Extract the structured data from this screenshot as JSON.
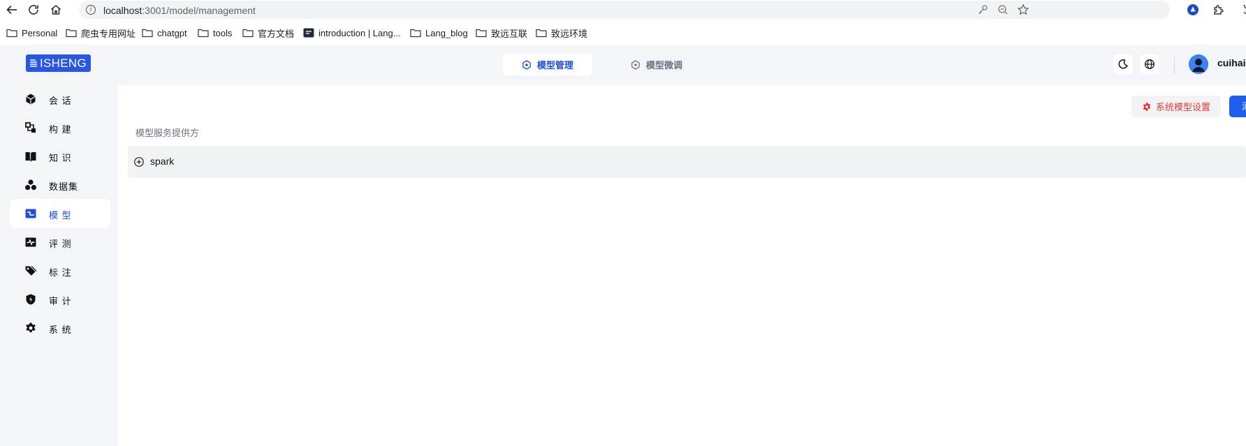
{
  "browser": {
    "url_host": "localhost",
    "url_path": ":3001/model/management",
    "bookmarks": [
      {
        "label": "Personal",
        "icon": "folder-icon"
      },
      {
        "label": "爬虫专用网址",
        "icon": "folder-icon"
      },
      {
        "label": "chatgpt",
        "icon": "folder-icon"
      },
      {
        "label": "tools",
        "icon": "folder-icon"
      },
      {
        "label": "官方文档",
        "icon": "folder-icon"
      },
      {
        "label": "introduction | Lang...",
        "icon": "site-icon"
      },
      {
        "label": "Lang_blog",
        "icon": "folder-icon"
      },
      {
        "label": "致远互联",
        "icon": "folder-icon"
      },
      {
        "label": "致远环境",
        "icon": "folder-icon"
      }
    ]
  },
  "header": {
    "logo_text": "ISHENG",
    "tabs": [
      {
        "label": "模型管理",
        "active": true
      },
      {
        "label": "模型微调",
        "active": false
      }
    ],
    "username": "cuihail"
  },
  "sidebar": {
    "items": [
      {
        "label": "会 话",
        "icon": "cube-icon",
        "active": false
      },
      {
        "label": "构 建",
        "icon": "build-icon",
        "active": false
      },
      {
        "label": "知 识",
        "icon": "book-icon",
        "active": false
      },
      {
        "label": "数据集",
        "icon": "dataset-icon",
        "active": false
      },
      {
        "label": "模 型",
        "icon": "model-icon",
        "active": true
      },
      {
        "label": "评 测",
        "icon": "pulse-icon",
        "active": false
      },
      {
        "label": "标 注",
        "icon": "tag-icon",
        "active": false
      },
      {
        "label": "审 计",
        "icon": "shield-icon",
        "active": false
      },
      {
        "label": "系 统",
        "icon": "gear-icon",
        "active": false
      }
    ]
  },
  "main": {
    "system_model_settings_label": "系统模型设置",
    "add_button_label": "添",
    "section_title": "模型服务提供方",
    "providers": [
      {
        "name": "spark"
      }
    ]
  },
  "colors": {
    "accent": "#1d4ed8",
    "logo_bg": "#2856e5",
    "danger": "#e53935",
    "page_bg": "#f4f5f8"
  }
}
